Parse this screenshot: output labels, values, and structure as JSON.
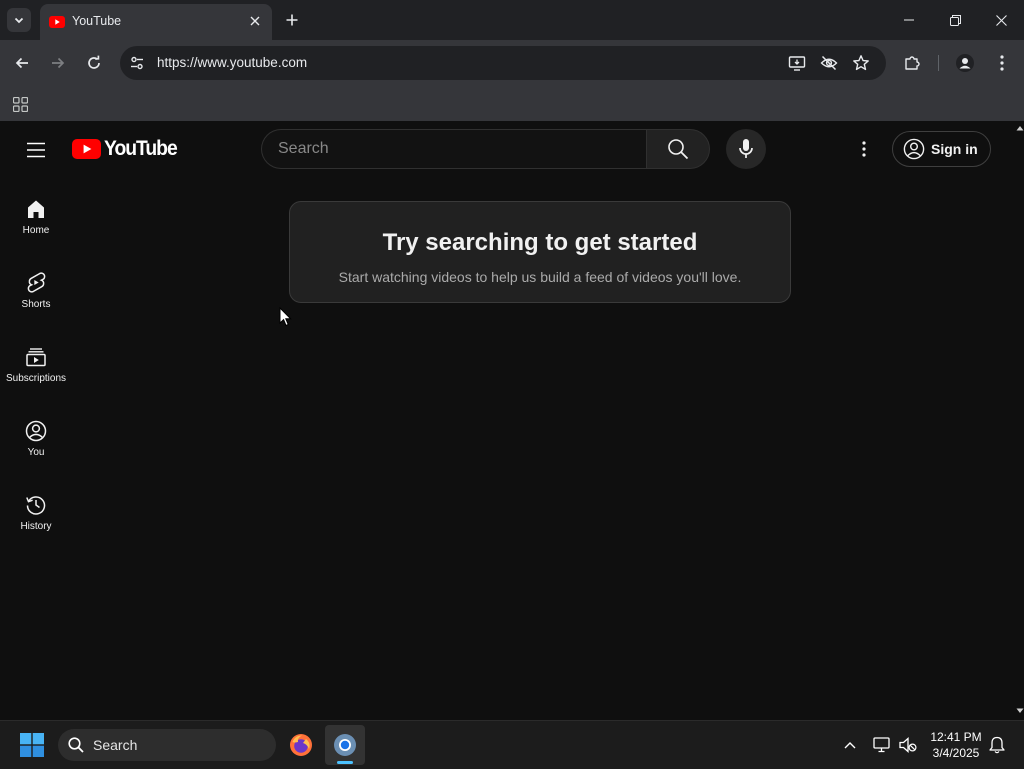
{
  "browser": {
    "tab_title": "YouTube",
    "url": "https://www.youtube.com"
  },
  "youtube": {
    "logo_text": "YouTube",
    "search_placeholder": "Search",
    "sign_in_label": "Sign in",
    "guide": [
      {
        "label": "Home",
        "icon": "home-icon"
      },
      {
        "label": "Shorts",
        "icon": "shorts-icon"
      },
      {
        "label": "Subscriptions",
        "icon": "subscriptions-icon"
      },
      {
        "label": "You",
        "icon": "you-icon"
      },
      {
        "label": "History",
        "icon": "history-icon"
      }
    ],
    "prompt": {
      "heading": "Try searching to get started",
      "subtext": "Start watching videos to help us build a feed of videos you'll love."
    }
  },
  "taskbar": {
    "search_placeholder": "Search",
    "time": "12:41 PM",
    "date": "3/4/2025"
  },
  "colors": {
    "youtube_red": "#ff0000",
    "page_bg": "#0f0f0f",
    "chrome_frame": "#202124",
    "chrome_toolbar": "#35363a"
  }
}
